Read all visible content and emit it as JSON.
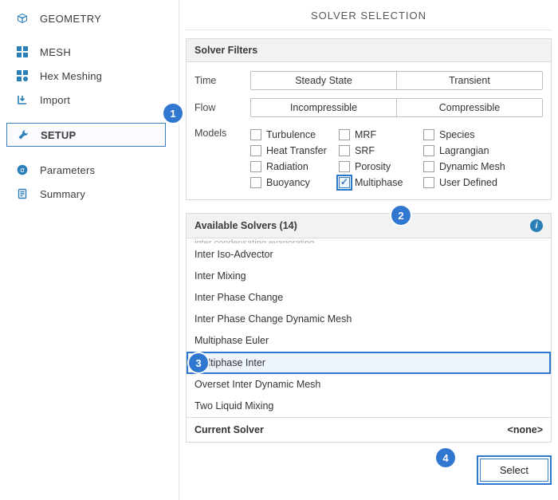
{
  "sidebar": {
    "items": [
      {
        "label": "GEOMETRY",
        "icon": "cube-wire"
      },
      {
        "label": "MESH",
        "icon": "grid-4"
      },
      {
        "label": "Hex Meshing",
        "icon": "grid-dot"
      },
      {
        "label": "Import",
        "icon": "import"
      },
      {
        "label": "SETUP",
        "icon": "wrench"
      },
      {
        "label": "Parameters",
        "icon": "alpha"
      },
      {
        "label": "Summary",
        "icon": "doc"
      }
    ]
  },
  "main": {
    "title": "SOLVER SELECTION",
    "filters_header": "Solver Filters",
    "time_label": "Time",
    "time_options": [
      "Steady State",
      "Transient"
    ],
    "flow_label": "Flow",
    "flow_options": [
      "Incompressible",
      "Compressible"
    ],
    "models_label": "Models",
    "models": [
      {
        "label": "Turbulence",
        "checked": false
      },
      {
        "label": "MRF",
        "checked": false
      },
      {
        "label": "Species",
        "checked": false
      },
      {
        "label": "Heat Transfer",
        "checked": false
      },
      {
        "label": "SRF",
        "checked": false
      },
      {
        "label": "Lagrangian",
        "checked": false
      },
      {
        "label": "Radiation",
        "checked": false
      },
      {
        "label": "Porosity",
        "checked": false
      },
      {
        "label": "Dynamic Mesh",
        "checked": false
      },
      {
        "label": "Buoyancy",
        "checked": false
      },
      {
        "label": "Multiphase",
        "checked": true
      },
      {
        "label": "User Defined",
        "checked": false
      }
    ],
    "solvers_header": "Available Solvers (14)",
    "solvers": [
      "Inter Iso-Advector",
      "Inter Mixing",
      "Inter Phase Change",
      "Inter Phase Change Dynamic Mesh",
      "Multiphase Euler",
      "Multiphase Inter",
      "Overset Inter Dynamic Mesh",
      "Two Liquid Mixing"
    ],
    "selected_solver_index": 5,
    "current_solver_label": "Current Solver",
    "current_solver_value": "<none>",
    "select_button": "Select"
  },
  "callouts": {
    "c1": "1",
    "c2": "2",
    "c3": "3",
    "c4": "4"
  }
}
